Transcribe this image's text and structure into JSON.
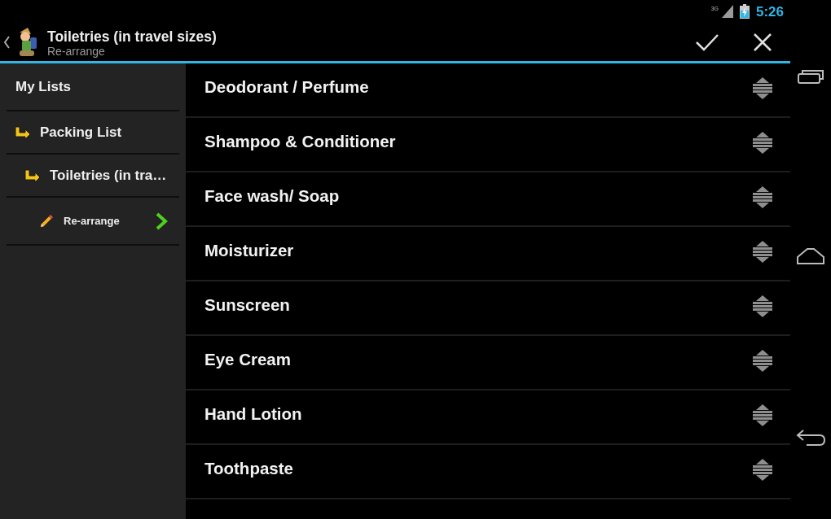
{
  "status_bar": {
    "network": "3G",
    "time": "5:26"
  },
  "action_bar": {
    "title": "Toiletries (in travel sizes)",
    "subtitle": "Re-arrange"
  },
  "sidebar": {
    "items": [
      {
        "kind": "root",
        "label": "My Lists",
        "selected": false,
        "children": [
          {
            "kind": "list",
            "label": "Packing List",
            "selected": false,
            "children": [
              {
                "kind": "list",
                "label": "Toiletries (in tra…",
                "selected": false,
                "children": [
                  {
                    "kind": "action",
                    "label": "Re-arrange",
                    "selected": true
                  }
                ]
              }
            ]
          }
        ]
      }
    ]
  },
  "list": {
    "items": [
      "Deodorant / Perfume",
      "Shampoo & Conditioner",
      "Face wash/ Soap",
      "Moisturizer",
      "Sunscreen",
      "Eye Cream",
      "Hand Lotion",
      "Toothpaste"
    ]
  }
}
